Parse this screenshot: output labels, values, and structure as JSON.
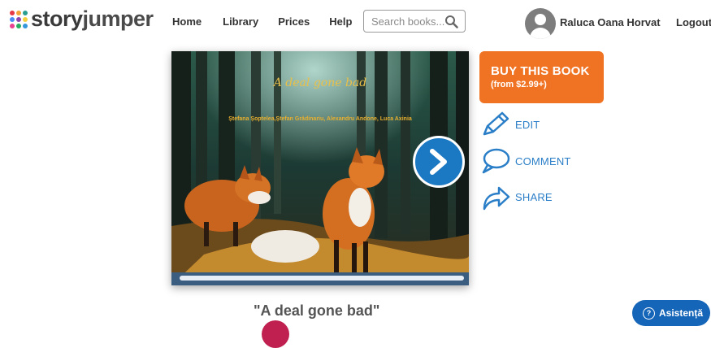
{
  "brand": {
    "name_part1": "story",
    "name_part2": "jumper",
    "dot_colors": [
      "#e63946",
      "#f4a236",
      "#2a9d8f",
      "#4c8bf5",
      "#8e44ad",
      "#f4d03f",
      "#e84393",
      "#27ae60",
      "#3498db"
    ]
  },
  "nav": {
    "items": [
      "Home",
      "Library",
      "Prices",
      "Help"
    ]
  },
  "search": {
    "placeholder": "Search books..."
  },
  "user": {
    "name": "Raluca Oana Horvat",
    "logout_label": "Logout"
  },
  "book": {
    "cover_title": "A deal gone bad",
    "cover_authors": "Ștefana Șoptelea,Ștefan Grădinariu, Alexandru Andone, Luca Axinia",
    "title_quoted": "\"A deal gone bad\""
  },
  "actions": {
    "buy_line1": "BUY THIS BOOK",
    "buy_line2": "(from $2.99+)",
    "edit": "EDIT",
    "comment": "COMMENT",
    "share": "SHARE"
  },
  "help": {
    "label": "Asistență"
  },
  "colors": {
    "accent_orange": "#f07324",
    "link_blue": "#2a7ec7",
    "next_blue": "#1b78c2"
  }
}
